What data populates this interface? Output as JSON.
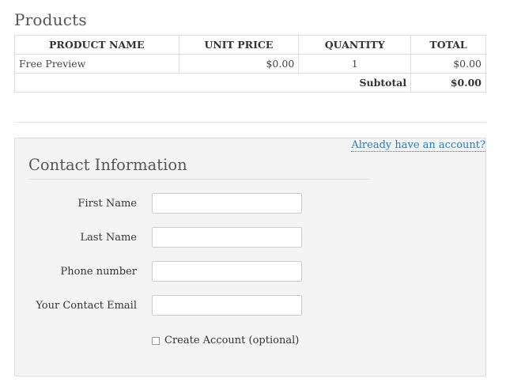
{
  "products": {
    "title": "Products",
    "columns": [
      "PRODUCT NAME",
      "UNIT PRICE",
      "QUANTITY",
      "TOTAL"
    ],
    "rows": [
      {
        "name": "Free Preview",
        "unit_price": "$0.00",
        "quantity": "1",
        "total": "$0.00"
      }
    ],
    "subtotal_label": "Subtotal",
    "subtotal_value": "$0.00"
  },
  "contact": {
    "account_link": "Already have an account?",
    "title": "Contact Information",
    "fields": [
      {
        "label": "First Name",
        "value": ""
      },
      {
        "label": "Last Name",
        "value": ""
      },
      {
        "label": "Phone number",
        "value": ""
      },
      {
        "label": "Your Contact Email",
        "value": ""
      }
    ],
    "create_account": {
      "label": "Create Account (optional)",
      "checked": false
    }
  }
}
